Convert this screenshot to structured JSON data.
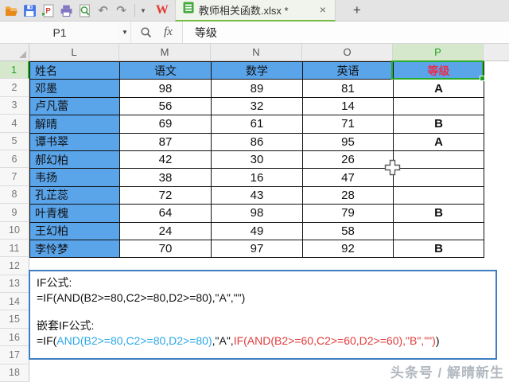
{
  "topbar": {
    "wps_logo": "W",
    "tab_title": "教师相关函数.xlsx *",
    "close_glyph": "×",
    "new_tab_glyph": "+",
    "undo_glyph": "↶",
    "redo_glyph": "↷",
    "icons": [
      "open",
      "save",
      "export-pdf",
      "print",
      "print-preview",
      "undo",
      "redo",
      "more-dropdown"
    ]
  },
  "formula_bar": {
    "name_box": "P1",
    "fx_label": "fx",
    "value": "等级"
  },
  "grid": {
    "col_headers": [
      "L",
      "M",
      "N",
      "O",
      "P"
    ],
    "row_headers": [
      "1",
      "2",
      "3",
      "4",
      "5",
      "6",
      "7",
      "8",
      "9",
      "10",
      "11",
      "12",
      "13",
      "14",
      "15",
      "16",
      "17",
      "18"
    ],
    "selected_cell": "P1",
    "selected_column": "P",
    "selected_row": "1"
  },
  "table": {
    "rows": [
      {
        "name": "姓名",
        "chinese": "语文",
        "math": "数学",
        "english": "英语",
        "grade": "等级"
      },
      {
        "name": "邓墨",
        "chinese": "98",
        "math": "89",
        "english": "81",
        "grade": "A"
      },
      {
        "name": "卢凡蕾",
        "chinese": "56",
        "math": "32",
        "english": "14",
        "grade": ""
      },
      {
        "name": "解晴",
        "chinese": "69",
        "math": "61",
        "english": "71",
        "grade": "B"
      },
      {
        "name": "谭书翠",
        "chinese": "87",
        "math": "86",
        "english": "95",
        "grade": "A"
      },
      {
        "name": "郝幻柏",
        "chinese": "42",
        "math": "30",
        "english": "26",
        "grade": ""
      },
      {
        "name": "韦扬",
        "chinese": "38",
        "math": "16",
        "english": "47",
        "grade": ""
      },
      {
        "name": "孔芷蕊",
        "chinese": "72",
        "math": "43",
        "english": "28",
        "grade": ""
      },
      {
        "name": "叶青槐",
        "chinese": "64",
        "math": "98",
        "english": "79",
        "grade": "B"
      },
      {
        "name": "王幻柏",
        "chinese": "24",
        "math": "49",
        "english": "58",
        "grade": ""
      },
      {
        "name": "李怜梦",
        "chinese": "70",
        "math": "97",
        "english": "92",
        "grade": "B"
      }
    ]
  },
  "formula_box": {
    "if_label": "IF公式:",
    "if_formula": "=IF(AND(B2>=80,C2>=80,D2>=80),\"A\",\"\")",
    "nested_label": "嵌套IF公式:",
    "nested_parts": {
      "p1": "=IF(",
      "p2": "AND(B2>=80,C2>=80,D2>=80)",
      "p3": ",\"A\",",
      "p4": "IF(AND(B2>=60,C2>=60,D2>=60),\"B\",\"\")",
      "p5": ")"
    }
  },
  "watermark": "头条号 / 解晴新生",
  "colors": {
    "cell_fill_blue": "#5AA4EA",
    "selection_green": "#2BAB2B",
    "grade_header_red": "#E8304E",
    "formula_blue": "#2BA7E8",
    "formula_red": "#E23B3B",
    "note_box_border": "#3E7FC1",
    "tab_underline": "#76B943",
    "selected_header_bg": "#D6E8CC",
    "selected_header_text": "#21A121"
  }
}
